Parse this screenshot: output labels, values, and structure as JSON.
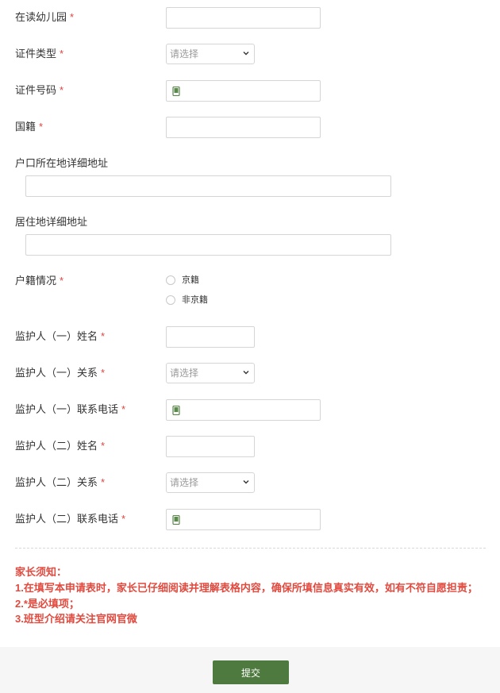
{
  "form": {
    "kindergarten_label": "在读幼儿园",
    "id_type_label": "证件类型",
    "id_type_placeholder": "请选择",
    "id_number_label": "证件号码",
    "nationality_label": "国籍",
    "hukou_address_label": "户口所在地详细地址",
    "residence_address_label": "居住地详细地址",
    "hukou_status_label": "户籍情况",
    "hukou_options": [
      "京籍",
      "非京籍"
    ],
    "guardian1_name_label": "监护人（一）姓名",
    "guardian1_relation_label": "监护人（一）关系",
    "guardian1_relation_placeholder": "请选择",
    "guardian1_phone_label": "监护人（一）联系电话",
    "guardian2_name_label": "监护人（二）姓名",
    "guardian2_relation_label": "监护人（二）关系",
    "guardian2_relation_placeholder": "请选择",
    "guardian2_phone_label": "监护人（二）联系电话",
    "required_mark": "*"
  },
  "notice": {
    "title": "家长须知：",
    "lines": [
      "1.在填写本申请表时，家长已仔细阅读并理解表格内容，确保所填信息真实有效，如有不符自愿担责；",
      "2.*是必填项；",
      "3.班型介绍请关注官网官微"
    ]
  },
  "footer": {
    "submit_label": "提交"
  },
  "colors": {
    "required": "#e0433f",
    "notice": "#e04a3f",
    "submit_bg": "#4f7a3f",
    "footer_bg": "#f6f6f6"
  },
  "icons": {
    "phone": "phone-icon",
    "select_arrow": "chevron-down-icon"
  }
}
